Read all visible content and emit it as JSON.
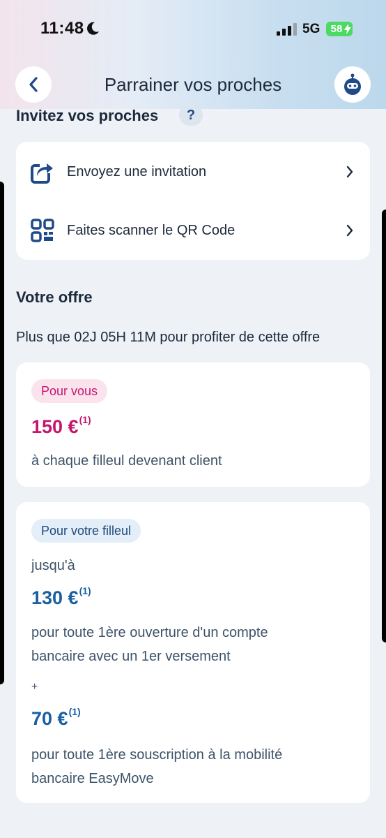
{
  "status_bar": {
    "time": "11:48",
    "network": "5G",
    "battery": "58"
  },
  "nav": {
    "title": "Parrainer vos proches"
  },
  "invite": {
    "heading": "Invitez vos proches",
    "help": "?",
    "actions": [
      {
        "label": "Envoyez une invitation",
        "icon": "share-icon"
      },
      {
        "label": "Faites scanner le QR Code",
        "icon": "qr-code-icon"
      }
    ]
  },
  "offer": {
    "heading": "Votre offre",
    "countdown": "Plus que 02J 05H 11M pour profiter de cette offre"
  },
  "for_you": {
    "badge": "Pour vous",
    "amount": "150 €",
    "note": "(1)",
    "description": "à chaque filleul devenant client"
  },
  "for_referee": {
    "badge": "Pour votre filleul",
    "intro": "jusqu'à",
    "amount1": "130 €",
    "note1": "(1)",
    "desc1_line1": "pour toute 1ère ouverture d'un compte",
    "desc1_line2": "bancaire avec un 1er versement",
    "plus": "+",
    "amount2": "70 €",
    "note2": "(1)",
    "desc2_line1": "pour toute 1ère souscription à la mobilité",
    "desc2_line2": "bancaire EasyMove"
  },
  "colors": {
    "accent_pink": "#c4166d",
    "accent_blue": "#1a5fa0",
    "icon_navy": "#1f4a8a"
  }
}
